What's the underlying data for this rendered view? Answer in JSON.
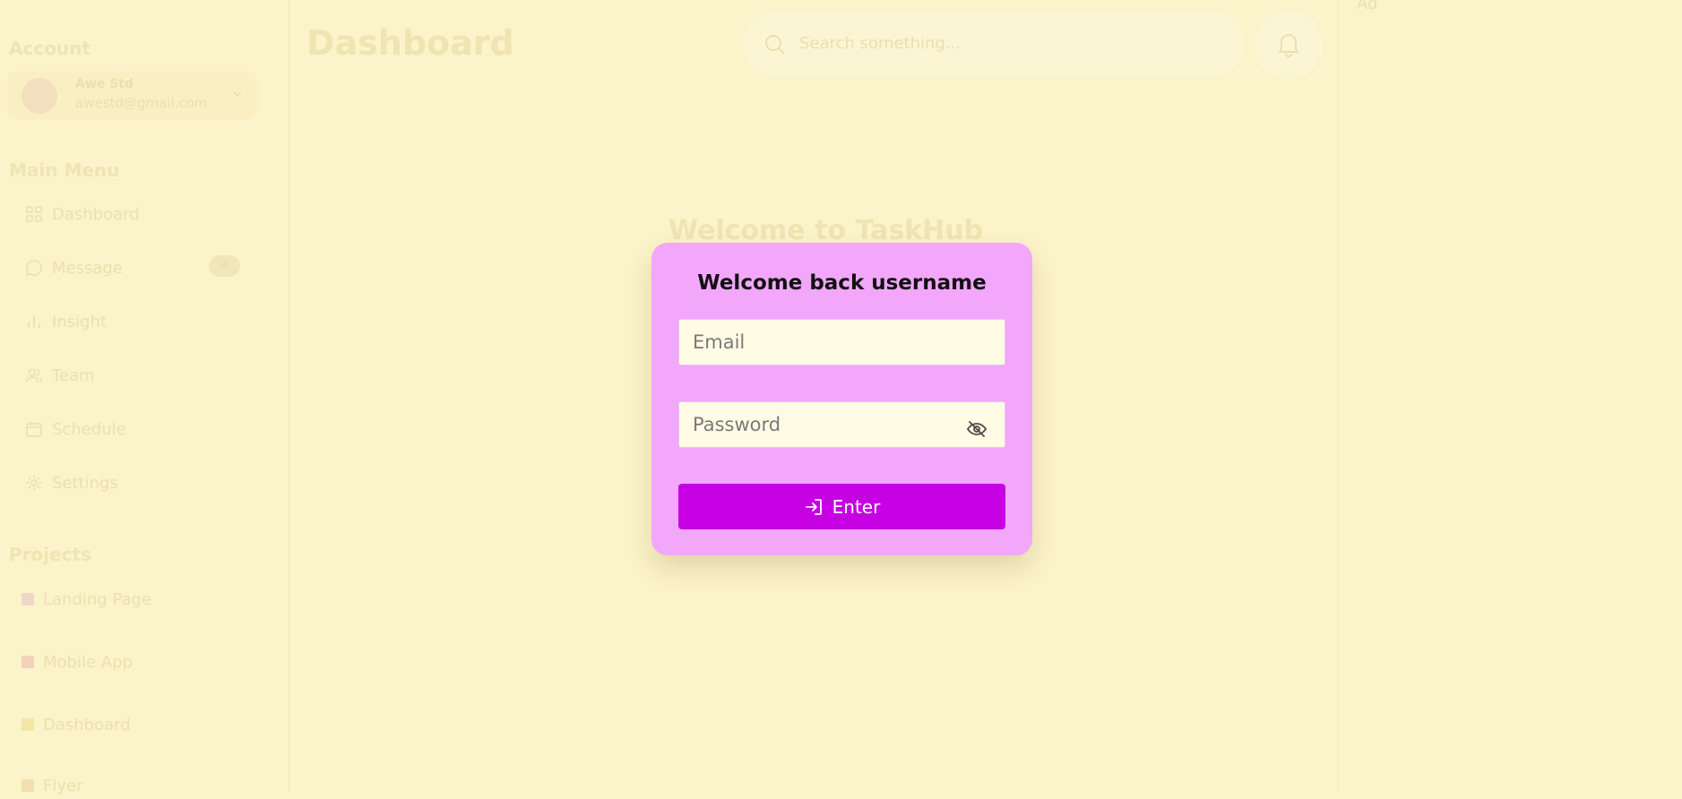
{
  "sidebar": {
    "account_title": "Account",
    "account": {
      "name": "Awe Std",
      "email": "awestd@gmail.com"
    },
    "menu_title": "Main Menu",
    "menu": [
      {
        "label": "Dashboard",
        "icon": "grid-icon"
      },
      {
        "label": "Message",
        "icon": "chat-icon",
        "badge": "4"
      },
      {
        "label": "Insight",
        "icon": "bar-chart-icon"
      },
      {
        "label": "Team",
        "icon": "users-icon"
      },
      {
        "label": "Schedule",
        "icon": "calendar-icon"
      },
      {
        "label": "Settings",
        "icon": "gear-icon"
      }
    ],
    "projects_title": "Projects",
    "projects": [
      {
        "label": "Landing Page",
        "color": "#eed7c9"
      },
      {
        "label": "Mobile App",
        "color": "#f2d2b8"
      },
      {
        "label": "Dashboard",
        "color": "#f4e6a6"
      },
      {
        "label": "Flyer",
        "color": "#f2dfb0"
      }
    ]
  },
  "header": {
    "title": "Dashboard",
    "search_placeholder": "Search something..."
  },
  "right_panel": {
    "label": "Ad"
  },
  "main": {
    "welcome": "Welcome to TaskHub"
  },
  "modal": {
    "title": "Welcome back username",
    "email_placeholder": "Email",
    "password_placeholder": "Password",
    "enter_label": "Enter"
  },
  "colors": {
    "background": "#fbf3c9",
    "modal_bg": "#f2a7fb",
    "accent": "#c600e3",
    "input_bg": "#fffbe4"
  }
}
